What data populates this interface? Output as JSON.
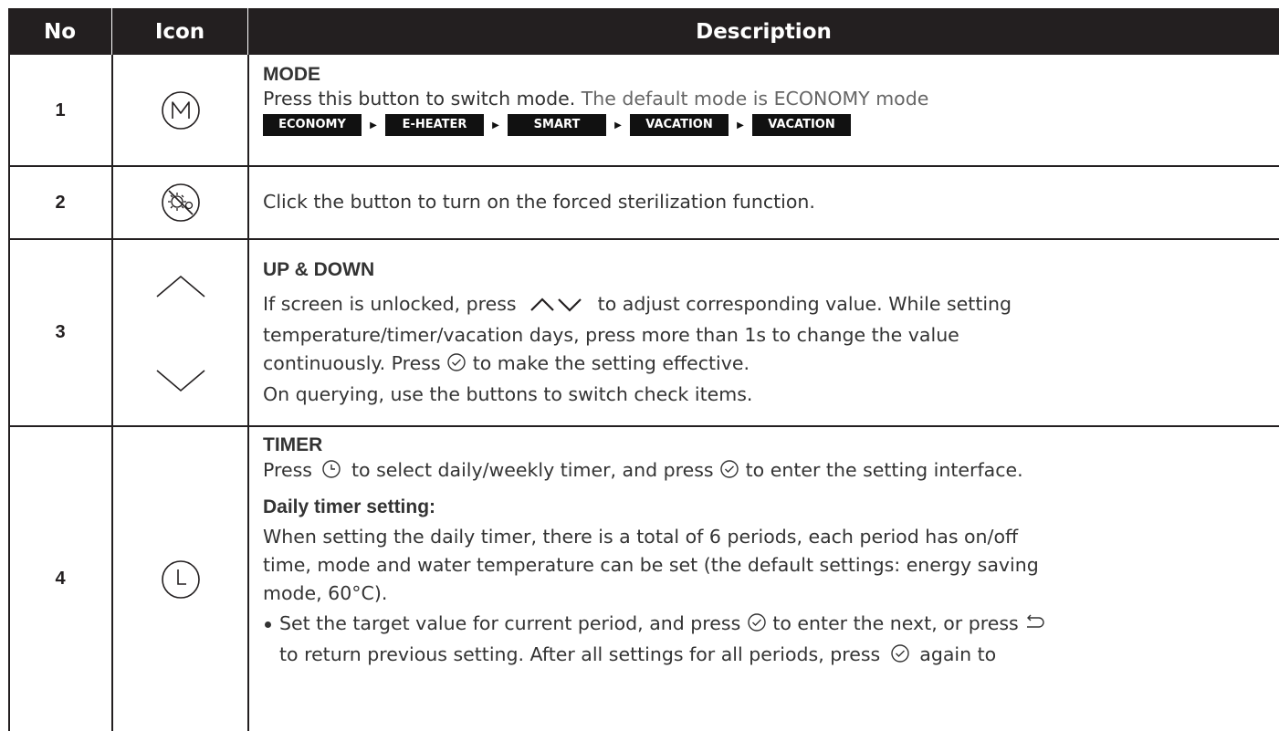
{
  "header": {
    "col_no": "No",
    "col_icon": "Icon",
    "col_desc": "Description"
  },
  "rows": [
    {
      "no": "1",
      "icon": "mode-m-icon",
      "title": "MODE",
      "text_a": "Press this button to switch mode.",
      "text_b": "The default mode is ECONOMY mode",
      "modes": [
        "ECONOMY",
        "E-HEATER",
        "SMART",
        "VACATION",
        "VACATION"
      ]
    },
    {
      "no": "2",
      "icon": "sterilization-icon",
      "text": "Click the button to turn on the forced sterilization function."
    },
    {
      "no": "3",
      "icon_up": "chevron-up-icon",
      "icon_down": "chevron-down-icon",
      "title": "UP & DOWN",
      "p1_a": "If screen is unlocked, press",
      "p1_b": "to adjust corresponding value. While setting",
      "p2": "temperature/timer/vacation days, press more than 1s to change the value",
      "p3_a": "continuously. Press",
      "p3_b": "to make the setting effective.",
      "p4": "On querying, use the buttons to switch check items."
    },
    {
      "no": "4",
      "icon": "timer-clock-icon",
      "title": "TIMER",
      "p1_a": "Press",
      "p1_b": "to select daily/weekly timer, and press",
      "p1_c": "to enter the setting interface.",
      "subtitle": "Daily timer setting:",
      "d1": "When setting the daily timer, there is a total of 6 periods, each period has on/off",
      "d2": "time, mode and water temperature can be set (the default settings: energy saving",
      "d3": "mode, 60°C).",
      "b1_a": "Set the target value for current period, and press",
      "b1_b": "to enter the next, or press",
      "b2_a": "to return previous setting. After all settings for all periods, press",
      "b2_b": "again to"
    }
  ]
}
